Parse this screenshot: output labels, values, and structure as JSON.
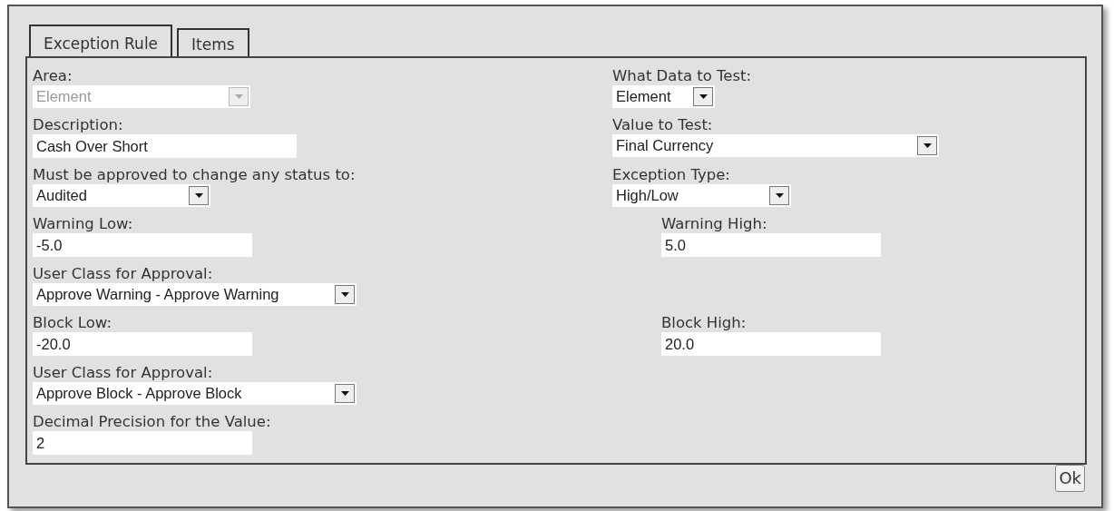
{
  "tabs": [
    {
      "label": "Exception Rule",
      "selected": true
    },
    {
      "label": "Items",
      "selected": false
    }
  ],
  "rows": [
    {
      "left": {
        "label": "Area:",
        "kind": "select",
        "value": "Element",
        "disabled": true
      },
      "right": {
        "label": "What Data to Test:",
        "kind": "select",
        "value": "Element",
        "disabled": false
      }
    },
    {
      "left": {
        "label": "Description:",
        "kind": "text",
        "value": "Cash Over Short",
        "disabled": false
      },
      "right": {
        "label": "Value to Test:",
        "kind": "select",
        "value": "Final Currency",
        "disabled": false
      }
    },
    {
      "left": {
        "label": "Must be approved to change any status to:",
        "kind": "select",
        "value": "Audited",
        "disabled": false
      },
      "right": {
        "label": "Exception Type:",
        "kind": "select",
        "value": "High/Low",
        "disabled": false
      }
    },
    {
      "left": {
        "label": "Warning Low:",
        "kind": "text",
        "value": "-5.0",
        "disabled": false
      },
      "right": {
        "label": "Warning High:",
        "kind": "text",
        "value": "5.0",
        "disabled": false
      }
    },
    {
      "left": {
        "label": "User Class for Approval:",
        "kind": "select",
        "value": "Approve Warning - Approve Warning",
        "disabled": false
      }
    },
    {
      "left": {
        "label": "Block Low:",
        "kind": "text",
        "value": "-20.0",
        "disabled": false
      },
      "right": {
        "label": "Block High:",
        "kind": "text",
        "value": "20.0",
        "disabled": false
      }
    },
    {
      "left": {
        "label": "User Class for Approval:",
        "kind": "select",
        "value": "Approve Block - Approve Block",
        "disabled": false
      }
    },
    {
      "left": {
        "label": "Decimal Precision for the Value:",
        "kind": "text",
        "value": "2",
        "disabled": false
      }
    }
  ],
  "ok_button": "Ok"
}
